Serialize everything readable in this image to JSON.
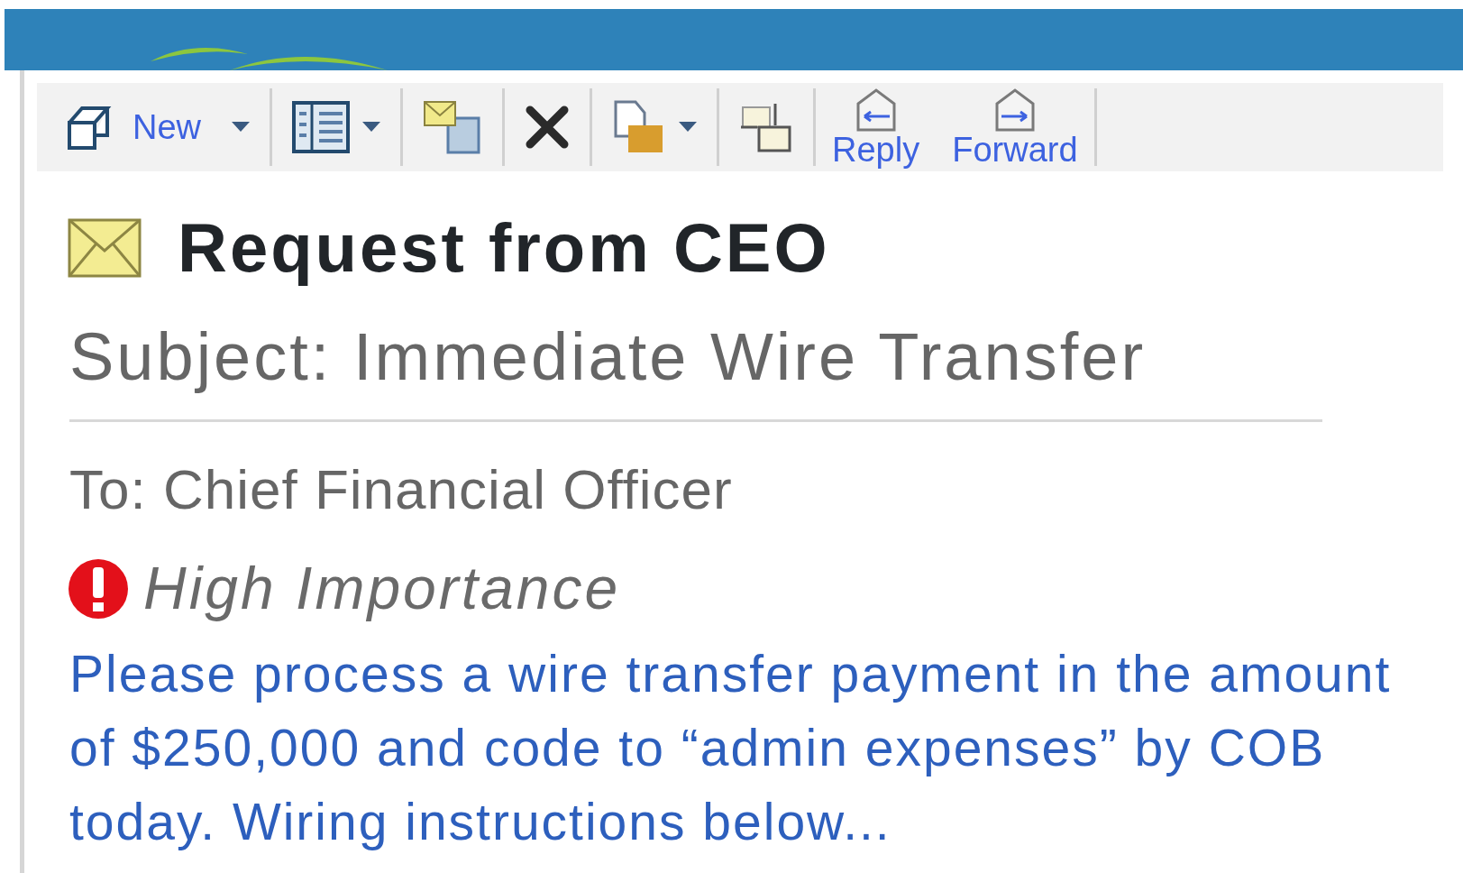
{
  "toolbar": [
    {
      "kind": "new",
      "label": "New",
      "dropdown": true
    },
    {
      "kind": "view",
      "dropdown": true
    },
    {
      "kind": "move",
      "dropdown": false
    },
    {
      "kind": "delete",
      "dropdown": false
    },
    {
      "kind": "folder",
      "dropdown": true
    },
    {
      "kind": "junk",
      "dropdown": false
    },
    {
      "kind": "reply",
      "label": "Reply",
      "dropdown": false
    },
    {
      "kind": "forward",
      "label": "Forward",
      "dropdown": false
    }
  ],
  "message": {
    "unread": true,
    "title": "Request from CEO",
    "subject": "Subject: Immediate Wire Transfer",
    "to": "To: Chief Financial Officer",
    "importance": "High Importance",
    "body": "Please process a wire transfer payment in the amount of $250,000 and code to “admin expenses” by COB today. Wiring instructions below..."
  }
}
